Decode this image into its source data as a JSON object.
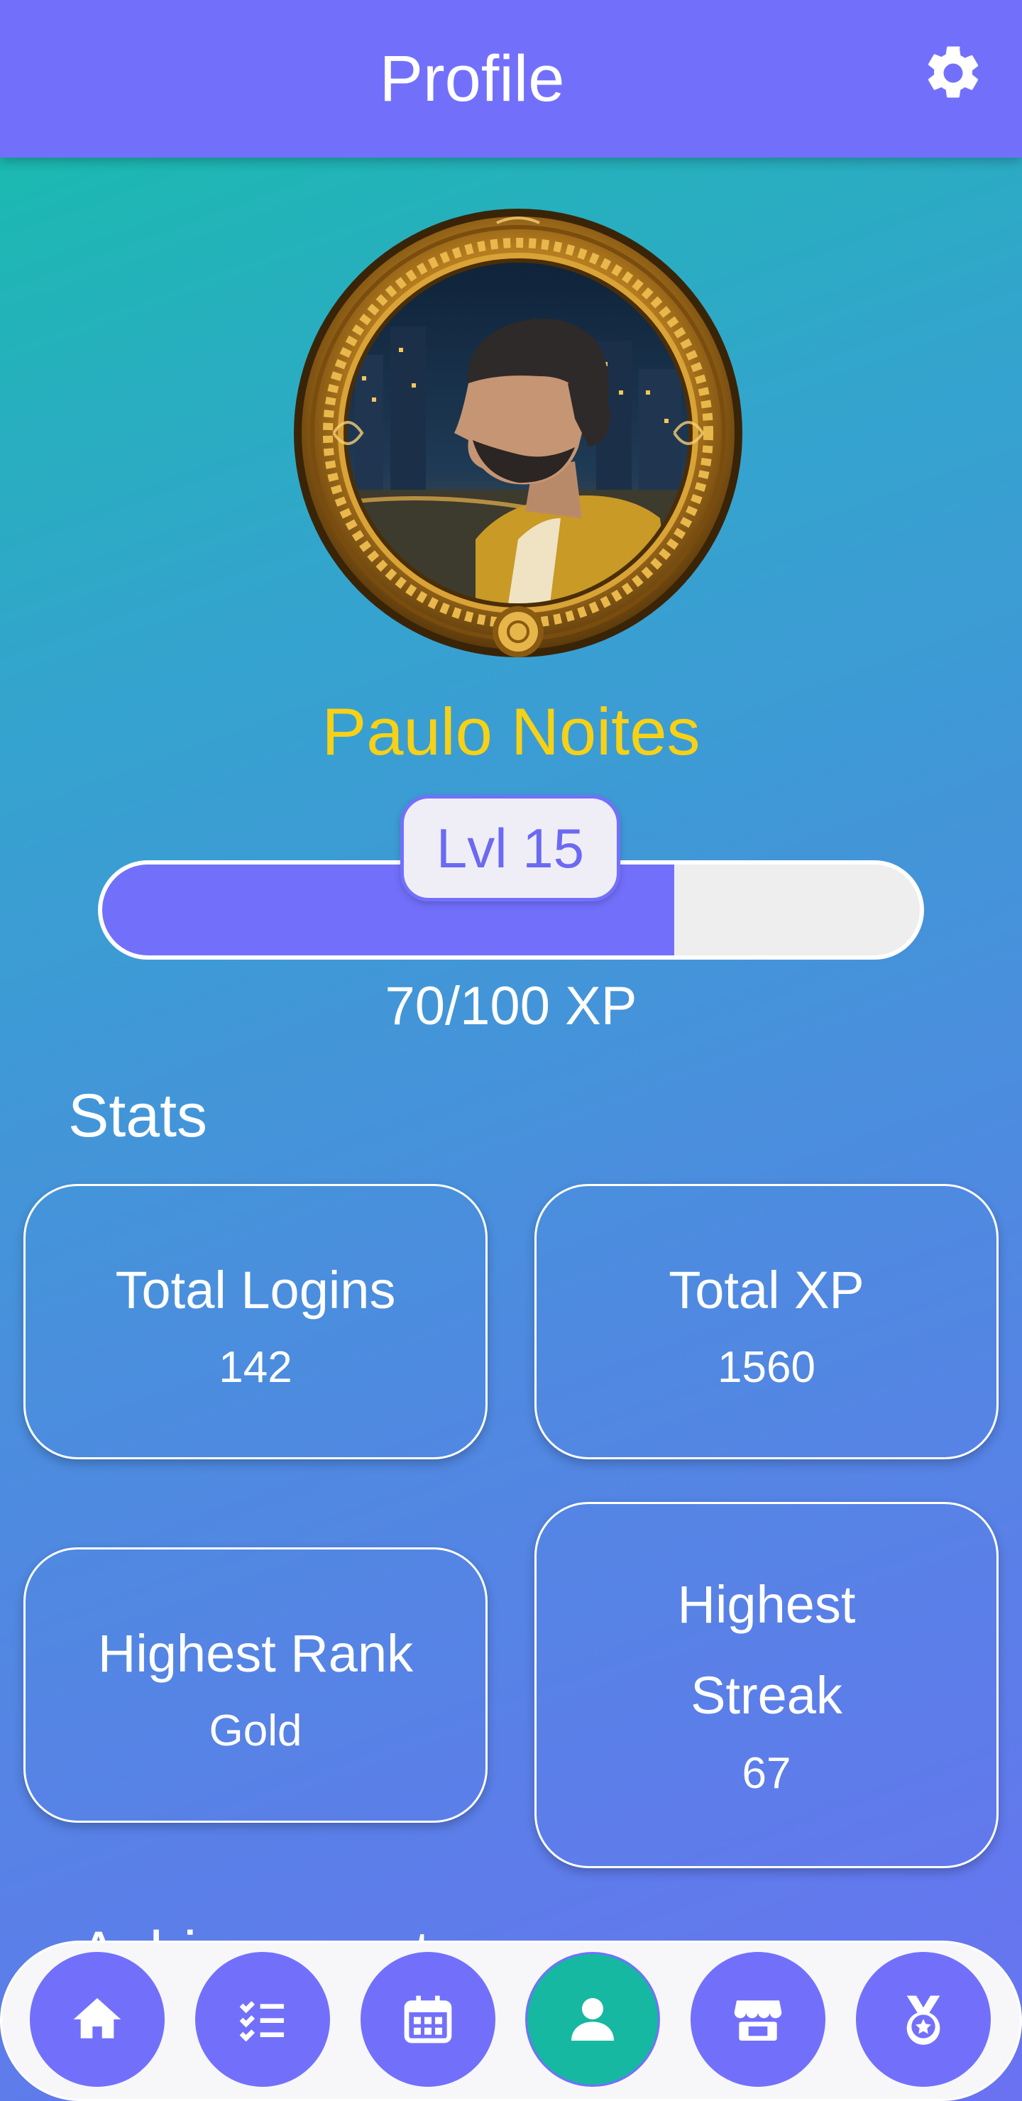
{
  "app_bar": {
    "title": "Profile",
    "settings_icon": "gear-icon",
    "color": "#7270fb"
  },
  "profile": {
    "name": "Paulo Noites",
    "name_color": "#f7d116",
    "avatar_icon": "avatar-portrait-framed"
  },
  "level": {
    "label": "Lvl 15",
    "xp_text": "70/100 XP",
    "xp_current": 70,
    "xp_max": 100,
    "fill_color": "#7270fb"
  },
  "stats": {
    "heading": "Stats",
    "cards": [
      {
        "label": "Total Logins",
        "value": "142"
      },
      {
        "label": "Total XP",
        "value": "1560"
      },
      {
        "label": "Highest Rank",
        "value": "Gold"
      },
      {
        "label": "Highest Streak",
        "label_line1": "Highest",
        "label_line2": "Streak",
        "value": "67"
      }
    ]
  },
  "next_section_partial": "Achievements",
  "bottom_nav": {
    "items": [
      {
        "icon": "home-icon",
        "active": false
      },
      {
        "icon": "checklist-icon",
        "active": false
      },
      {
        "icon": "calendar-icon",
        "active": false
      },
      {
        "icon": "profile-icon",
        "active": true
      },
      {
        "icon": "store-icon",
        "active": false
      },
      {
        "icon": "medal-icon",
        "active": false
      }
    ],
    "active_color": "#16b8a2",
    "button_color": "#7270fb"
  }
}
